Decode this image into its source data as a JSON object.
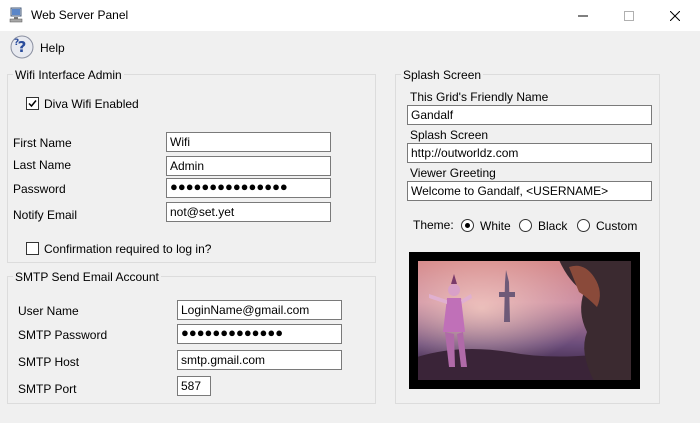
{
  "window": {
    "title": "Web Server Panel"
  },
  "menu": {
    "help_label": "Help"
  },
  "wifi": {
    "legend": "Wifi Interface Admin",
    "enabled_label": "Diva Wifi Enabled",
    "enabled": true,
    "first_name_label": "First Name",
    "first_name_value": "Wifi",
    "last_name_label": "Last Name",
    "last_name_value": "Admin",
    "password_label": "Password",
    "password_value": "●●●●●●●●●●●●●●●",
    "notify_email_label": "Notify Email",
    "notify_email_value": "not@set.yet",
    "confirmation_label": "Confirmation required to log in?",
    "confirmation_checked": false
  },
  "smtp": {
    "legend": "SMTP Send Email Account",
    "user_name_label": "User Name",
    "user_name_value": "LoginName@gmail.com",
    "password_label": "SMTP Password",
    "password_value": "●●●●●●●●●●●●●",
    "host_label": "SMTP Host",
    "host_value": "smtp.gmail.com",
    "port_label": "SMTP Port",
    "port_value": "587"
  },
  "splash": {
    "legend": "Splash Screen",
    "grid_name_label": "This Grid's Friendly Name",
    "grid_name_value": "Gandalf",
    "splash_label": "Splash Screen",
    "splash_value": "http://outworldz.com",
    "greeting_label": "Viewer Greeting",
    "greeting_value": "Welcome to Gandalf, <USERNAME>",
    "theme_label": "Theme:",
    "themes": [
      "White",
      "Black",
      "Custom"
    ],
    "selected_theme": "White"
  }
}
